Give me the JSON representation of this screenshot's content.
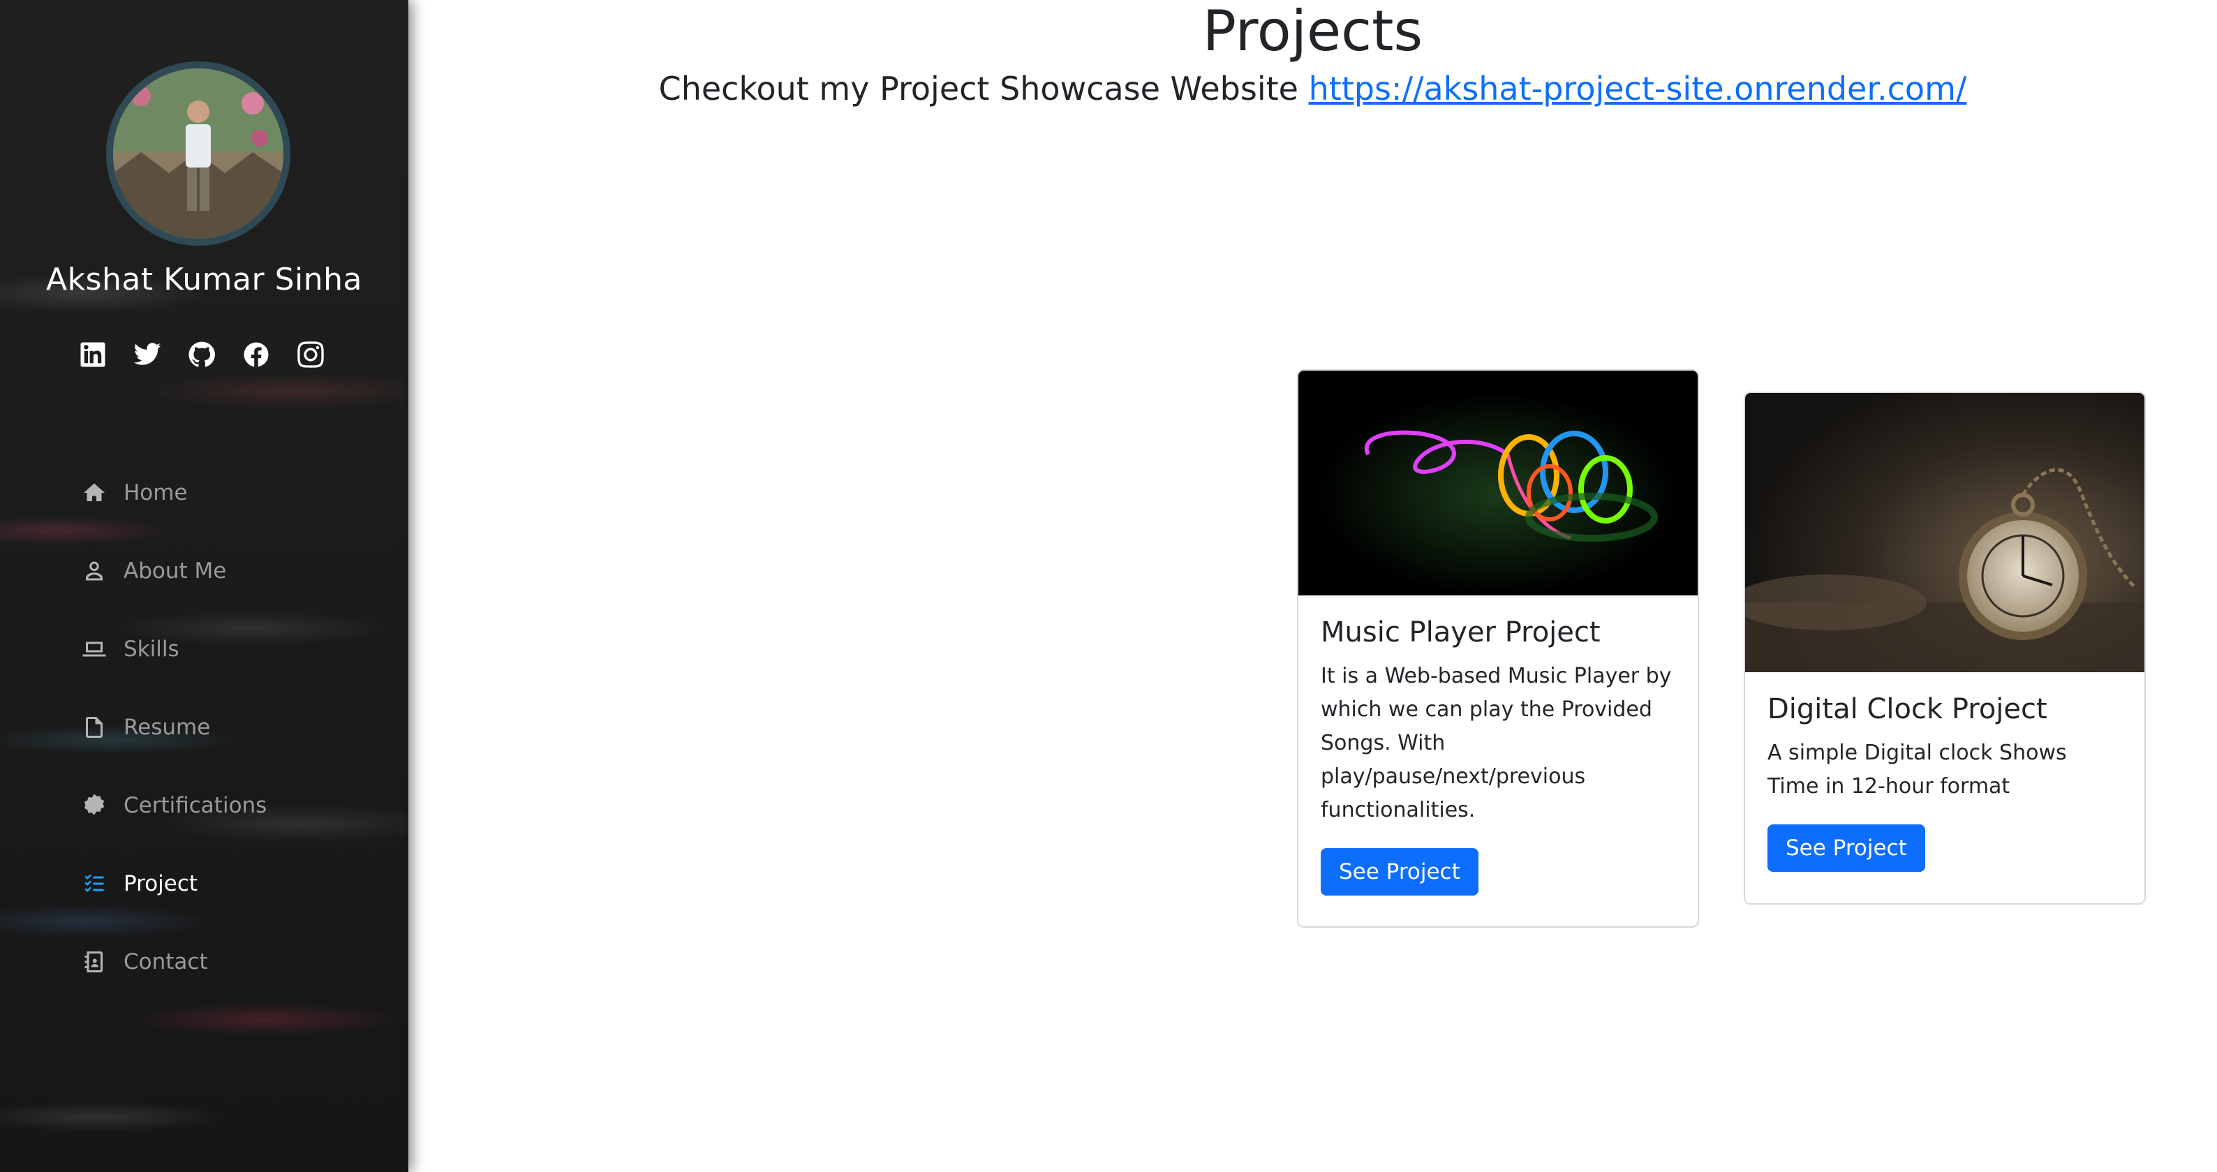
{
  "sidebar": {
    "profile_name": "Akshat Kumar Sinha",
    "social_icons": [
      "linkedin-icon",
      "twitter-icon",
      "github-icon",
      "facebook-icon",
      "instagram-icon"
    ],
    "nav": [
      {
        "label": "Home",
        "icon": "home-icon",
        "active": false
      },
      {
        "label": "About Me",
        "icon": "person-icon",
        "active": false
      },
      {
        "label": "Skills",
        "icon": "laptop-icon",
        "active": false
      },
      {
        "label": "Resume",
        "icon": "file-icon",
        "active": false
      },
      {
        "label": "Certifications",
        "icon": "badge-icon",
        "active": false
      },
      {
        "label": "Project",
        "icon": "list-check-icon",
        "active": true
      },
      {
        "label": "Contact",
        "icon": "contact-card-icon",
        "active": false
      }
    ],
    "active_color": "#1aa3ff"
  },
  "main": {
    "title": "Projects",
    "subtitle_text": "Checkout my Project Showcase Website ",
    "subtitle_link": "https://akshat-project-site.onrender.com/",
    "cards": [
      {
        "title": "Music Player Project",
        "text": "It is a Web-based Music Player by which we can play the Provided Songs. With play/pause/next/previous functionalities.",
        "button": "See Project",
        "image": "neon-headphones-image"
      },
      {
        "title": "Digital Clock Project",
        "text": "A simple Digital clock Shows Time in 12-hour format",
        "button": "See Project",
        "image": "pocket-watch-image"
      }
    ],
    "button_color": "#0d6efd"
  }
}
